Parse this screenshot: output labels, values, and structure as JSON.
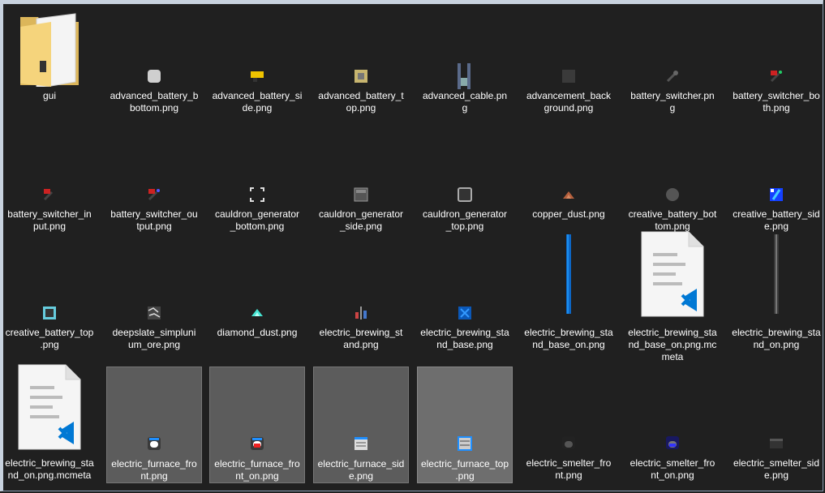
{
  "files": [
    {
      "name": "gui",
      "icon": "folder-icon"
    },
    {
      "name": "advanced_battery_bottom.png",
      "icon": "battery-bottom-texture-icon"
    },
    {
      "name": "advanced_battery_side.png",
      "icon": "battery-side-texture-icon"
    },
    {
      "name": "advanced_battery_top.png",
      "icon": "battery-top-texture-icon"
    },
    {
      "name": "advanced_cable.png",
      "icon": "cable-texture-icon"
    },
    {
      "name": "advancement_background.png",
      "icon": "background-texture-icon"
    },
    {
      "name": "battery_switcher.png",
      "icon": "switcher-texture-icon"
    },
    {
      "name": "battery_switcher_both.png",
      "icon": "switcher-both-texture-icon"
    },
    {
      "name": "battery_switcher_input.png",
      "icon": "switcher-input-texture-icon"
    },
    {
      "name": "battery_switcher_output.png",
      "icon": "switcher-output-texture-icon"
    },
    {
      "name": "cauldron_generator_bottom.png",
      "icon": "generator-bottom-texture-icon"
    },
    {
      "name": "cauldron_generator_side.png",
      "icon": "generator-side-texture-icon"
    },
    {
      "name": "cauldron_generator_top.png",
      "icon": "generator-top-texture-icon"
    },
    {
      "name": "copper_dust.png",
      "icon": "copper-dust-texture-icon"
    },
    {
      "name": "creative_battery_bottom.png",
      "icon": "creative-battery-bottom-texture-icon"
    },
    {
      "name": "creative_battery_side.png",
      "icon": "creative-battery-side-texture-icon"
    },
    {
      "name": "creative_battery_top.png",
      "icon": "creative-battery-top-texture-icon"
    },
    {
      "name": "deepslate_simplunium_ore.png",
      "icon": "ore-texture-icon"
    },
    {
      "name": "diamond_dust.png",
      "icon": "diamond-dust-texture-icon"
    },
    {
      "name": "electric_brewing_stand.png",
      "icon": "brewing-stand-texture-icon"
    },
    {
      "name": "electric_brewing_stand_base.png",
      "icon": "brewing-base-texture-icon"
    },
    {
      "name": "electric_brewing_stand_base_on.png",
      "icon": "brewing-base-on-strip-icon"
    },
    {
      "name": "electric_brewing_stand_base_on.png.mcmeta",
      "icon": "vscode-file-icon"
    },
    {
      "name": "electric_brewing_stand_on.png",
      "icon": "brewing-on-strip-icon"
    },
    {
      "name": "electric_brewing_stand_on.png.mcmeta",
      "icon": "vscode-file-icon"
    },
    {
      "name": "electric_furnace_front.png",
      "icon": "furnace-front-texture-icon"
    },
    {
      "name": "electric_furnace_front_on.png",
      "icon": "furnace-front-on-texture-icon"
    },
    {
      "name": "electric_furnace_side.png",
      "icon": "furnace-side-texture-icon"
    },
    {
      "name": "electric_furnace_top.png",
      "icon": "furnace-top-texture-icon"
    },
    {
      "name": "electric_smelter_front.png",
      "icon": "smelter-front-texture-icon"
    },
    {
      "name": "electric_smelter_front_on.png",
      "icon": "smelter-front-on-texture-icon"
    },
    {
      "name": "electric_smelter_side.png",
      "icon": "smelter-side-texture-icon"
    }
  ],
  "labels": [
    [
      "gui"
    ],
    [
      "advanced_battery_b",
      "bottom.png"
    ],
    [
      "advanced_battery_si",
      "de.png"
    ],
    [
      "advanced_battery_t",
      "op.png"
    ],
    [
      "advanced_cable.pn",
      "g"
    ],
    [
      "advancement_back",
      "ground.png"
    ],
    [
      "battery_switcher.pn",
      "g"
    ],
    [
      "battery_switcher_bo",
      "th.png"
    ],
    [
      "battery_switcher_in",
      "put.png"
    ],
    [
      "battery_switcher_ou",
      "tput.png"
    ],
    [
      "cauldron_generator",
      "_bottom.png"
    ],
    [
      "cauldron_generator",
      "_side.png"
    ],
    [
      "cauldron_generator",
      "_top.png"
    ],
    [
      "copper_dust.png"
    ],
    [
      "creative_battery_bot",
      "tom.png"
    ],
    [
      "creative_battery_sid",
      "e.png"
    ],
    [
      "creative_battery_top",
      ".png"
    ],
    [
      "deepslate_simpluni",
      "um_ore.png"
    ],
    [
      "diamond_dust.png"
    ],
    [
      "electric_brewing_st",
      "and.png"
    ],
    [
      "electric_brewing_sta",
      "nd_base.png"
    ],
    [
      "electric_brewing_sta",
      "nd_base_on.png"
    ],
    [
      "electric_brewing_sta",
      "nd_base_on.png.mc",
      "meta"
    ],
    [
      "electric_brewing_sta",
      "nd_on.png"
    ],
    [
      "electric_brewing_sta",
      "nd_on.png.mcmeta"
    ],
    [
      "electric_furnace_fro",
      "nt.png"
    ],
    [
      "electric_furnace_fro",
      "nt_on.png"
    ],
    [
      "electric_furnace_sid",
      "e.png"
    ],
    [
      "electric_furnace_top",
      ".png"
    ],
    [
      "electric_smelter_fro",
      "nt.png"
    ],
    [
      "electric_smelter_fro",
      "nt_on.png"
    ],
    [
      "electric_smelter_sid",
      "e.png"
    ]
  ],
  "colors": {
    "background": "#202020",
    "selection": "#5c5c5c",
    "text": "#ffffff",
    "vscode_blue": "#0078d4"
  }
}
